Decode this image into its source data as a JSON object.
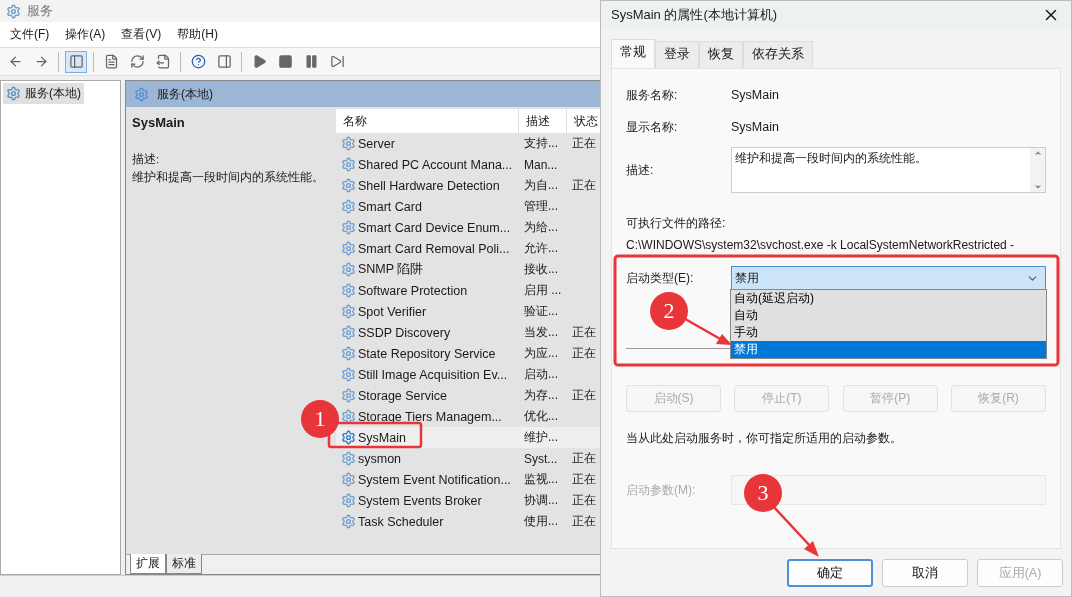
{
  "services_window": {
    "title": "服务",
    "menu": [
      "文件(F)",
      "操作(A)",
      "查看(V)",
      "帮助(H)"
    ],
    "tree": [
      {
        "label": "服务(本地)",
        "selected": true
      }
    ],
    "pane_header": "服务(本地)",
    "detail": {
      "name": "SysMain",
      "description_label": "描述:",
      "description": "维护和提高一段时间内的系统性能。"
    },
    "table": {
      "columns": [
        "名称",
        "描述",
        "状态"
      ],
      "rows": [
        {
          "name": "Server",
          "description": "支持...",
          "status": "正在",
          "selected": false
        },
        {
          "name": "Shared PC Account Mana...",
          "description": "Man...",
          "selected": false
        },
        {
          "name": "Shell Hardware Detection",
          "description": "为自...",
          "status": "正在",
          "selected": false
        },
        {
          "name": "Smart Card",
          "description": "管理...",
          "selected": false
        },
        {
          "name": "Smart Card Device Enum...",
          "description": "为给...",
          "selected": false
        },
        {
          "name": "Smart Card Removal Poli...",
          "description": "允许...",
          "selected": false
        },
        {
          "name": "SNMP 陷阱",
          "description": "接收...",
          "selected": false
        },
        {
          "name": "Software Protection",
          "description": "启用 ...",
          "selected": false
        },
        {
          "name": "Spot Verifier",
          "description": "验证...",
          "selected": false
        },
        {
          "name": "SSDP Discovery",
          "description": "当发...",
          "status": "正在",
          "selected": false
        },
        {
          "name": "State Repository Service",
          "description": "为应...",
          "status": "正在",
          "selected": false
        },
        {
          "name": "Still Image Acquisition Ev...",
          "description": "启动...",
          "selected": false
        },
        {
          "name": "Storage Service",
          "description": "为存...",
          "status": "正在",
          "selected": false
        },
        {
          "name": "Storage Tiers Managem...",
          "description": "优化...",
          "selected": false
        },
        {
          "name": "SysMain",
          "description": "维护...",
          "selected": true
        },
        {
          "name": "sysmon",
          "description": "Syst...",
          "status": "正在",
          "selected": false
        },
        {
          "name": "System Event Notification...",
          "description": "监视...",
          "status": "正在",
          "selected": false
        },
        {
          "name": "System Events Broker",
          "description": "协调...",
          "status": "正在",
          "selected": false
        },
        {
          "name": "Task Scheduler",
          "description": "使用...",
          "status": "正在",
          "selected": false
        }
      ]
    },
    "view_tabs": [
      {
        "label": "扩展",
        "selected": true
      },
      {
        "label": "标准",
        "selected": false
      }
    ]
  },
  "dialog": {
    "title": "SysMain 的属性(本地计算机)",
    "tabs": [
      {
        "label": "常规",
        "selected": true
      },
      {
        "label": "登录",
        "selected": false
      },
      {
        "label": "恢复",
        "selected": false
      },
      {
        "label": "依存关系",
        "selected": false
      }
    ],
    "service_name": {
      "label": "服务名称:",
      "value": "SysMain"
    },
    "display_name": {
      "label": "显示名称:",
      "value": "SysMain"
    },
    "description": {
      "label": "描述:",
      "value": "维护和提高一段时间内的系统性能。"
    },
    "path": {
      "label": "可执行文件的路径:",
      "value": "C:\\WINDOWS\\system32\\svchost.exe -k LocalSystemNetworkRestricted -"
    },
    "startup_type": {
      "label": "启动类型(E):",
      "value": "禁用",
      "expanded": true,
      "options": [
        {
          "label": "自动(延迟启动)",
          "selected": false
        },
        {
          "label": "自动",
          "selected": false
        },
        {
          "label": "手动",
          "selected": false
        },
        {
          "label": "禁用",
          "selected": true
        }
      ]
    },
    "service_buttons": [
      {
        "label": "启动(S)",
        "disabled": true
      },
      {
        "label": "停止(T)",
        "disabled": true
      },
      {
        "label": "暂停(P)",
        "disabled": true
      },
      {
        "label": "恢复(R)",
        "disabled": true
      }
    ],
    "hint": "当从此处启动服务时，你可指定所适用的启动参数。",
    "start_params": {
      "label": "启动参数(M):",
      "disabled": true
    },
    "footer_buttons": [
      {
        "label": "确定",
        "kind": "primary",
        "disabled": false
      },
      {
        "label": "取消",
        "kind": "normal",
        "disabled": false
      },
      {
        "label": "应用(A)",
        "kind": "normal",
        "disabled": true
      }
    ]
  },
  "annotations": [
    {
      "label": "1"
    },
    {
      "label": "2"
    },
    {
      "label": "3"
    }
  ]
}
